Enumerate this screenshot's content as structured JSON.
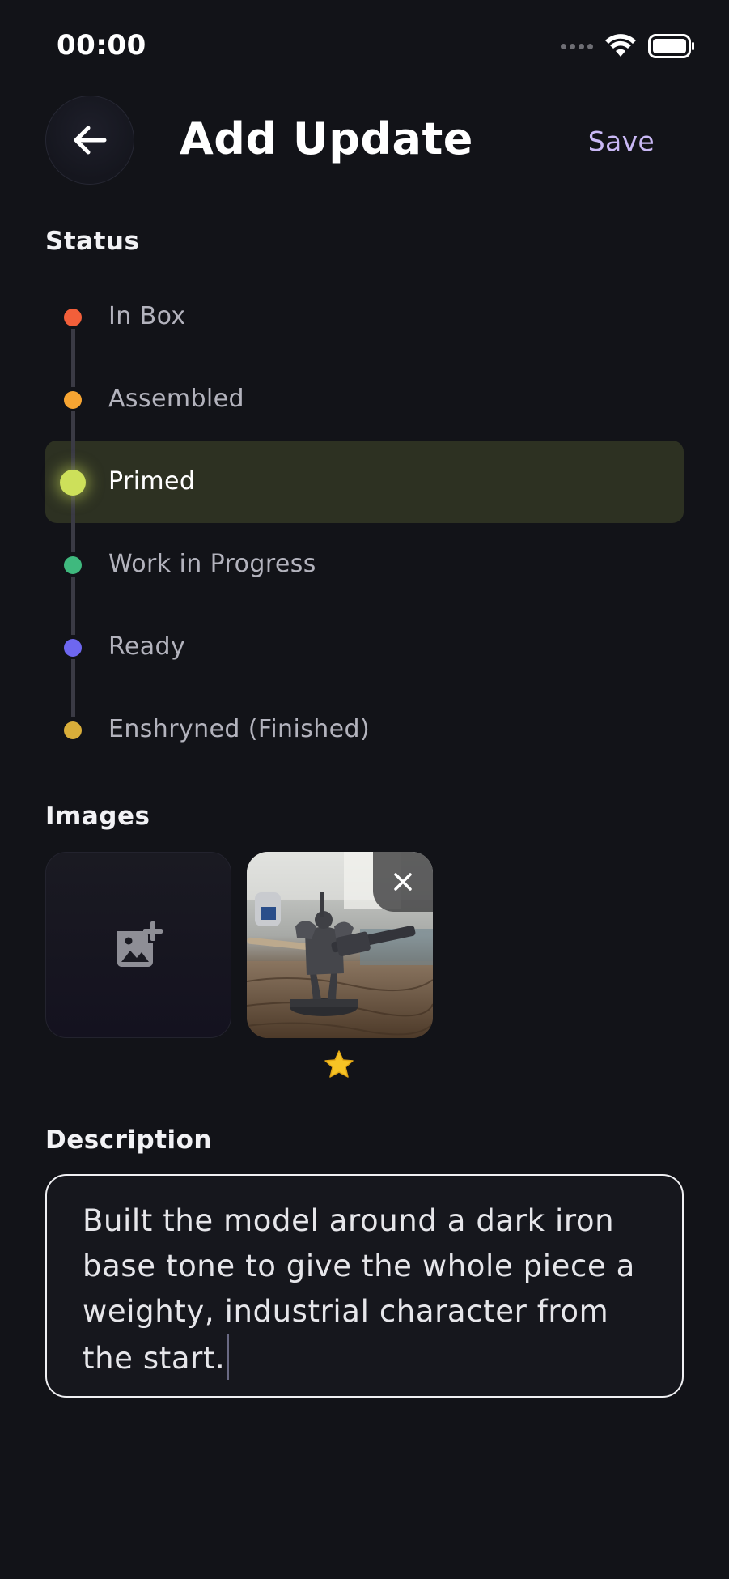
{
  "status_bar": {
    "time": "00:00"
  },
  "header": {
    "title": "Add Update",
    "save_label": "Save",
    "back_icon": "arrow-left-icon"
  },
  "status_section": {
    "label": "Status",
    "selected_index": 2,
    "items": [
      {
        "label": "In Box",
        "color": "#f25f3a"
      },
      {
        "label": "Assembled",
        "color": "#f7a532"
      },
      {
        "label": "Primed",
        "color": "#cde05a"
      },
      {
        "label": "Work in Progress",
        "color": "#3fb97e"
      },
      {
        "label": "Ready",
        "color": "#6e67f0"
      },
      {
        "label": "Enshryned (Finished)",
        "color": "#d9ae3a"
      }
    ]
  },
  "images_section": {
    "label": "Images",
    "add_icon": "add-photo-icon",
    "images": [
      {
        "alt": "painted miniature photo",
        "favorite": true
      }
    ]
  },
  "description_section": {
    "label": "Description",
    "value": "Built the model around a dark iron base tone to give the whole piece a weighty, industrial character from the start."
  }
}
